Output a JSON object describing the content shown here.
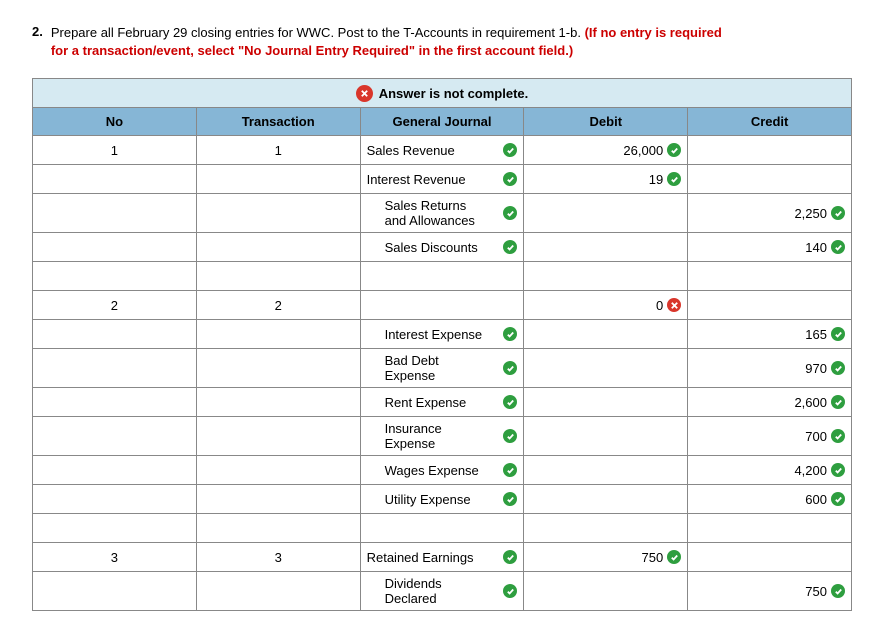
{
  "question": {
    "number": "2.",
    "text_black": "Prepare all February 29 closing entries for WWC. Post to the T-Accounts in requirement 1-b. ",
    "text_red": "(If no entry is required for a transaction/event, select \"No Journal Entry Required\" in the first account field.)"
  },
  "banner": "Answer is not complete.",
  "headers": {
    "no": "No",
    "transaction": "Transaction",
    "gj": "General Journal",
    "debit": "Debit",
    "credit": "Credit"
  },
  "rows": [
    {
      "no": "1",
      "trx": "1",
      "gj": "Sales Revenue",
      "gj_mark": "ok",
      "indent": false,
      "debit": "26,000",
      "debit_mark": "ok",
      "credit": "",
      "credit_mark": ""
    },
    {
      "no": "",
      "trx": "",
      "gj": "Interest Revenue",
      "gj_mark": "ok",
      "indent": false,
      "debit": "19",
      "debit_mark": "ok",
      "credit": "",
      "credit_mark": ""
    },
    {
      "no": "",
      "trx": "",
      "gj": "Sales Returns and Allowances",
      "gj_mark": "ok",
      "indent": true,
      "debit": "",
      "debit_mark": "",
      "credit": "2,250",
      "credit_mark": "ok"
    },
    {
      "no": "",
      "trx": "",
      "gj": "Sales Discounts",
      "gj_mark": "ok",
      "indent": true,
      "debit": "",
      "debit_mark": "",
      "credit": "140",
      "credit_mark": "ok"
    },
    {
      "no": "",
      "trx": "",
      "gj": "",
      "gj_mark": "",
      "indent": false,
      "debit": "",
      "debit_mark": "",
      "credit": "",
      "credit_mark": ""
    },
    {
      "no": "2",
      "trx": "2",
      "gj": "",
      "gj_mark": "",
      "indent": false,
      "debit": "0",
      "debit_mark": "bad",
      "credit": "",
      "credit_mark": ""
    },
    {
      "no": "",
      "trx": "",
      "gj": "Interest Expense",
      "gj_mark": "ok",
      "indent": true,
      "debit": "",
      "debit_mark": "",
      "credit": "165",
      "credit_mark": "ok"
    },
    {
      "no": "",
      "trx": "",
      "gj": "Bad Debt Expense",
      "gj_mark": "ok",
      "indent": true,
      "debit": "",
      "debit_mark": "",
      "credit": "970",
      "credit_mark": "ok"
    },
    {
      "no": "",
      "trx": "",
      "gj": "Rent Expense",
      "gj_mark": "ok",
      "indent": true,
      "debit": "",
      "debit_mark": "",
      "credit": "2,600",
      "credit_mark": "ok"
    },
    {
      "no": "",
      "trx": "",
      "gj": "Insurance Expense",
      "gj_mark": "ok",
      "indent": true,
      "debit": "",
      "debit_mark": "",
      "credit": "700",
      "credit_mark": "ok"
    },
    {
      "no": "",
      "trx": "",
      "gj": "Wages Expense",
      "gj_mark": "ok",
      "indent": true,
      "debit": "",
      "debit_mark": "",
      "credit": "4,200",
      "credit_mark": "ok"
    },
    {
      "no": "",
      "trx": "",
      "gj": "Utility Expense",
      "gj_mark": "ok",
      "indent": true,
      "debit": "",
      "debit_mark": "",
      "credit": "600",
      "credit_mark": "ok"
    },
    {
      "no": "",
      "trx": "",
      "gj": "",
      "gj_mark": "",
      "indent": false,
      "debit": "",
      "debit_mark": "",
      "credit": "",
      "credit_mark": ""
    },
    {
      "no": "3",
      "trx": "3",
      "gj": "Retained Earnings",
      "gj_mark": "ok",
      "indent": false,
      "debit": "750",
      "debit_mark": "ok",
      "credit": "",
      "credit_mark": ""
    },
    {
      "no": "",
      "trx": "",
      "gj": "Dividends Declared",
      "gj_mark": "ok",
      "indent": true,
      "debit": "",
      "debit_mark": "",
      "credit": "750",
      "credit_mark": "ok"
    }
  ]
}
